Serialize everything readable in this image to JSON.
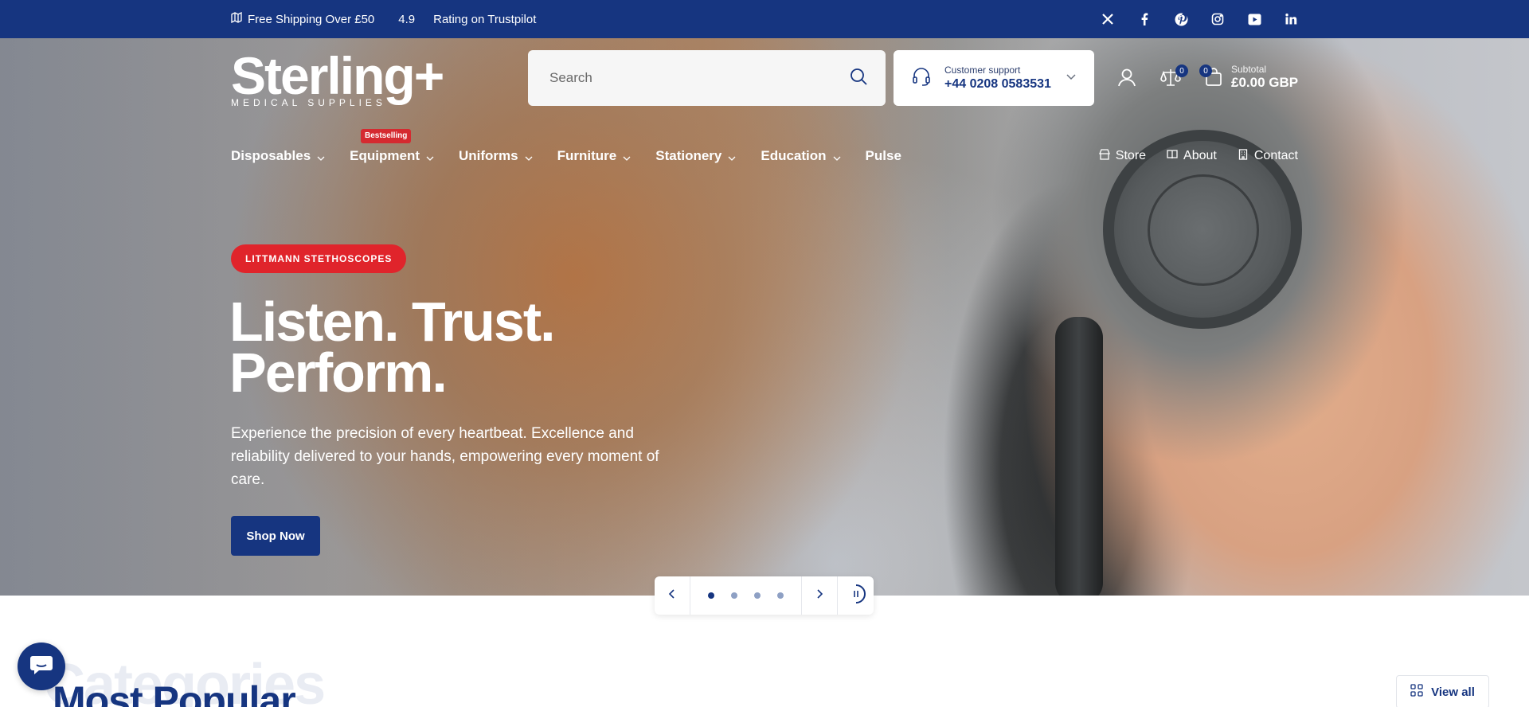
{
  "topbar": {
    "shipping": "Free Shipping Over £50",
    "rating_value": "4.9",
    "rating_text": "Rating on Trustpilot",
    "social_icons": [
      "x-icon",
      "facebook-icon",
      "pinterest-icon",
      "instagram-icon",
      "youtube-icon",
      "linkedin-icon"
    ]
  },
  "header": {
    "logo_name": "Sterling+",
    "logo_sub": "MEDICAL SUPPLIES",
    "search_placeholder": "Search",
    "support_label": "Customer support",
    "support_phone": "+44 0208 0583531",
    "compare_count": "0",
    "cart_count": "0",
    "subtotal_label": "Subtotal",
    "subtotal_value": "£0.00 GBP"
  },
  "nav": {
    "items": [
      {
        "label": "Disposables"
      },
      {
        "label": "Equipment",
        "badge": "Bestselling"
      },
      {
        "label": "Uniforms"
      },
      {
        "label": "Furniture"
      },
      {
        "label": "Stationery"
      },
      {
        "label": "Education"
      },
      {
        "label": "Pulse"
      }
    ],
    "right": [
      {
        "label": "Store",
        "icon": "store-icon"
      },
      {
        "label": "About",
        "icon": "book-icon"
      },
      {
        "label": "Contact",
        "icon": "building-icon"
      }
    ]
  },
  "hero": {
    "tag": "LITTMANN STETHOSCOPES",
    "headline_line1": "Listen. Trust.",
    "headline_line2": "Perform.",
    "subcopy": "Experience the precision of every heartbeat. Excellence and reliability delivered to your hands, empowering every moment of care.",
    "cta": "Shop Now",
    "slides_total": 4,
    "active_slide": 1
  },
  "section": {
    "bg_word": "Categories",
    "title": "Most Popular",
    "view_all": "View all"
  },
  "colors": {
    "brand_blue": "#163580",
    "accent_red": "#e0242b"
  }
}
